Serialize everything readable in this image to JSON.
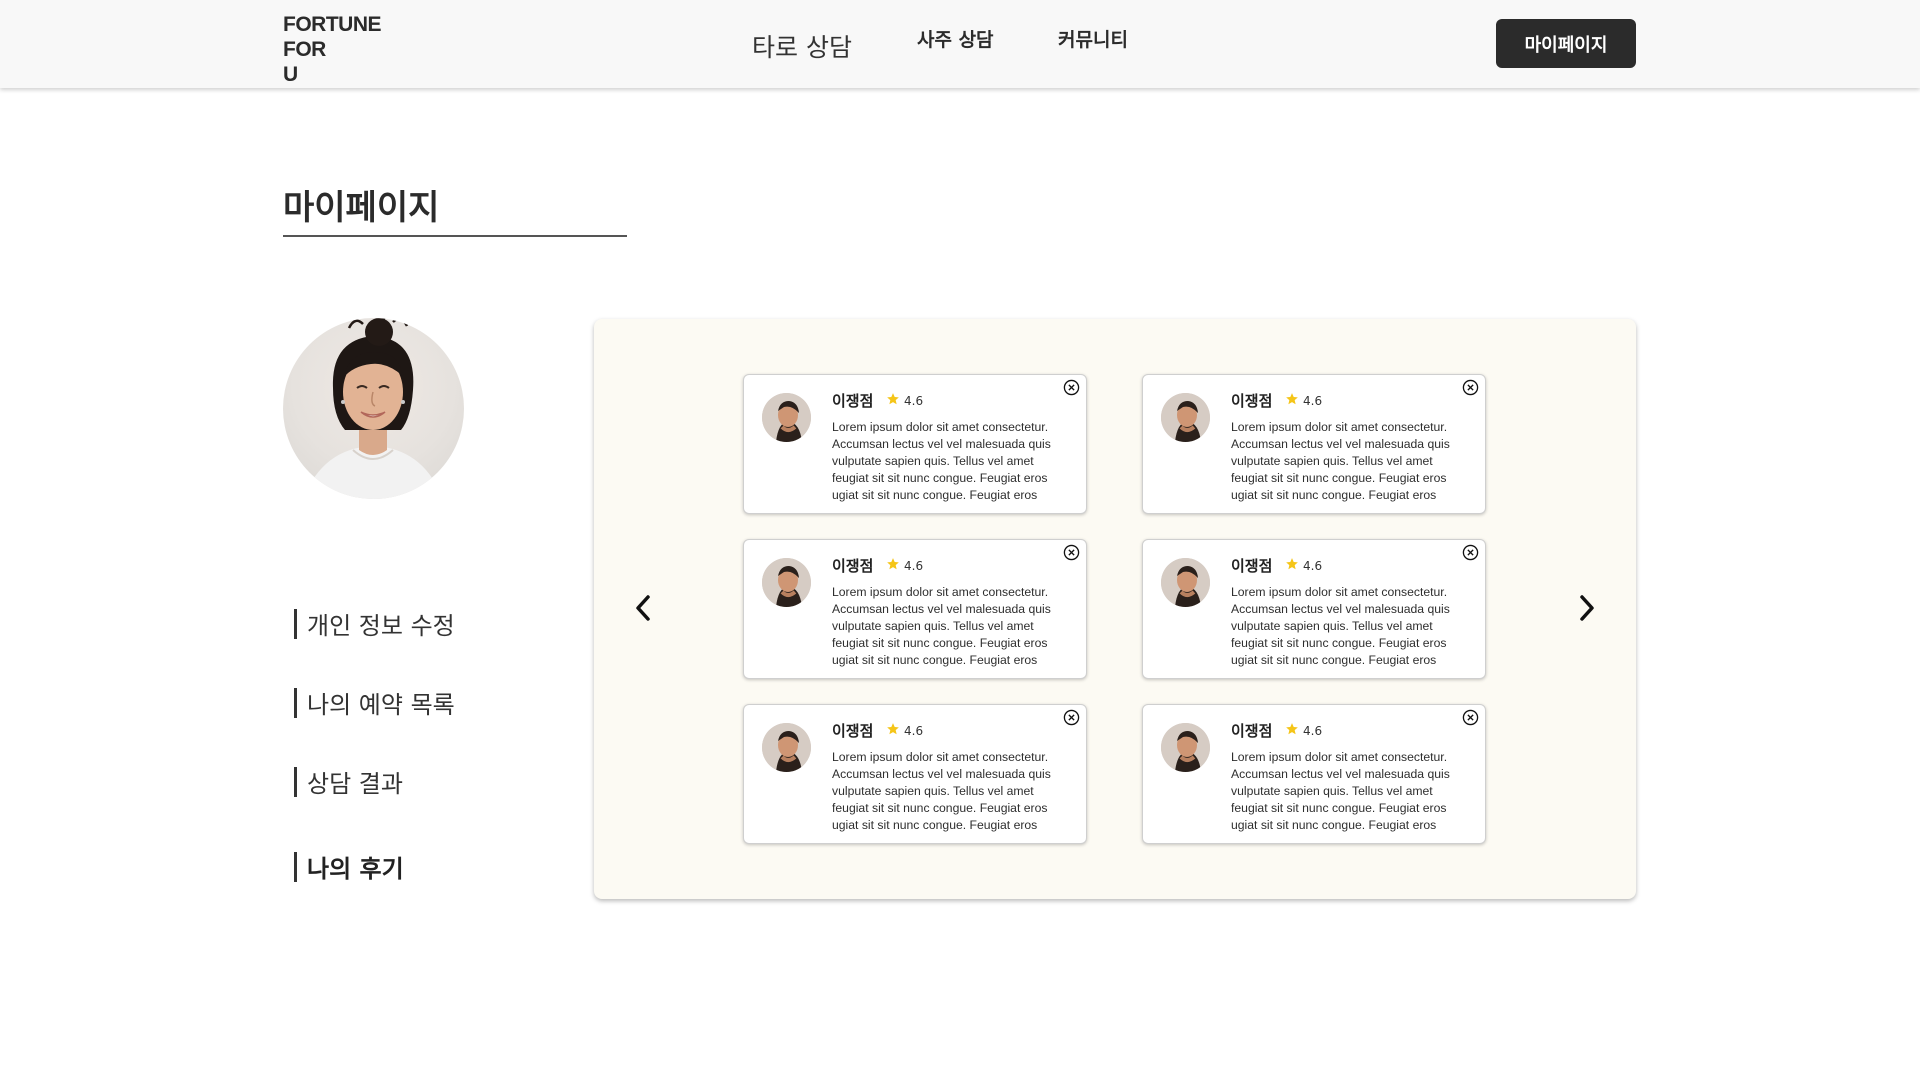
{
  "header": {
    "logo_lines": [
      "FORTUNE",
      "FOR",
      "U"
    ],
    "nav": {
      "tarot": "타로 상담",
      "saju": "사주 상담",
      "community": "커뮤니티"
    },
    "mypage_button": "마이페이지"
  },
  "page": {
    "title": "마이페이지"
  },
  "sidebar": {
    "items": [
      {
        "label": "개인 정보 수정"
      },
      {
        "label": "나의 예약 목록"
      },
      {
        "label": "상담 결과"
      },
      {
        "label": "나의 후기",
        "active": true
      }
    ]
  },
  "reviews": {
    "cards": [
      {
        "name": "이쟁점",
        "rating": "4.6",
        "text": "Lorem ipsum dolor sit amet consectetur.\nAccumsan lectus vel vel malesuada quis\nvulputate sapien quis. Tellus vel amet\nfeugiat sit sit nunc congue. Feugiat eros\nugiat sit sit nunc congue. Feugiat eros"
      },
      {
        "name": "이쟁점",
        "rating": "4.6",
        "text": "Lorem ipsum dolor sit amet consectetur.\nAccumsan lectus vel vel malesuada quis\nvulputate sapien quis. Tellus vel amet\nfeugiat sit sit nunc congue. Feugiat eros\nugiat sit sit nunc congue. Feugiat eros"
      },
      {
        "name": "이쟁점",
        "rating": "4.6",
        "text": "Lorem ipsum dolor sit amet consectetur.\nAccumsan lectus vel vel malesuada quis\nvulputate sapien quis. Tellus vel amet\nfeugiat sit sit nunc congue. Feugiat eros\nugiat sit sit nunc congue. Feugiat eros"
      },
      {
        "name": "이쟁점",
        "rating": "4.6",
        "text": "Lorem ipsum dolor sit amet consectetur.\nAccumsan lectus vel vel malesuada quis\nvulputate sapien quis. Tellus vel amet\nfeugiat sit sit nunc congue. Feugiat eros\nugiat sit sit nunc congue. Feugiat eros"
      },
      {
        "name": "이쟁점",
        "rating": "4.6",
        "text": "Lorem ipsum dolor sit amet consectetur.\nAccumsan lectus vel vel malesuada quis\nvulputate sapien quis. Tellus vel amet\nfeugiat sit sit nunc congue. Feugiat eros\nugiat sit sit nunc congue. Feugiat eros"
      },
      {
        "name": "이쟁점",
        "rating": "4.6",
        "text": "Lorem ipsum dolor sit amet consectetur.\nAccumsan lectus vel vel malesuada quis\nvulputate sapien quis. Tellus vel amet\nfeugiat sit sit nunc congue. Feugiat eros\nugiat sit sit nunc congue. Feugiat eros"
      }
    ],
    "star_color": "#f5c518"
  },
  "icons": {
    "prev": "chevron-left-icon",
    "next": "chevron-right-icon",
    "close": "close-circle-icon",
    "star": "star-icon"
  },
  "colors": {
    "header_bg": "#f8f8f8",
    "button_bg": "#2b2b2b",
    "panel_bg": "#fcfaf3",
    "text": "#2b2b2b"
  }
}
